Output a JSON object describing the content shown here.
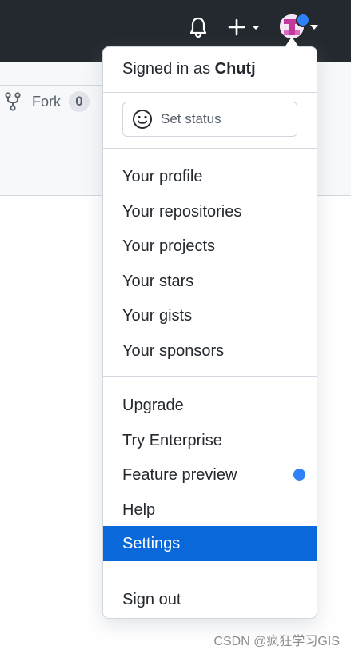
{
  "header": {
    "icons": [
      "bell-icon",
      "plus-icon",
      "caret-down-icon",
      "avatar",
      "notification-dot"
    ],
    "colors": {
      "bar": "#24292f",
      "dot": "#2f81f7"
    }
  },
  "repo": {
    "fork_label": "Fork",
    "fork_count": "0"
  },
  "dropdown": {
    "signed_in_prefix": "Signed in as",
    "username": "Chutj",
    "set_status": "Set status",
    "section1": [
      "Your profile",
      "Your repositories",
      "Your projects",
      "Your stars",
      "Your gists",
      "Your sponsors"
    ],
    "section2": [
      "Upgrade",
      "Try Enterprise",
      "Feature preview",
      "Help",
      "Settings"
    ],
    "active_item": "Settings",
    "sign_out": "Sign out",
    "colors": {
      "active_bg": "#0969da",
      "active_text": "#ffffff"
    }
  },
  "watermark": "CSDN @疯狂学习GIS"
}
